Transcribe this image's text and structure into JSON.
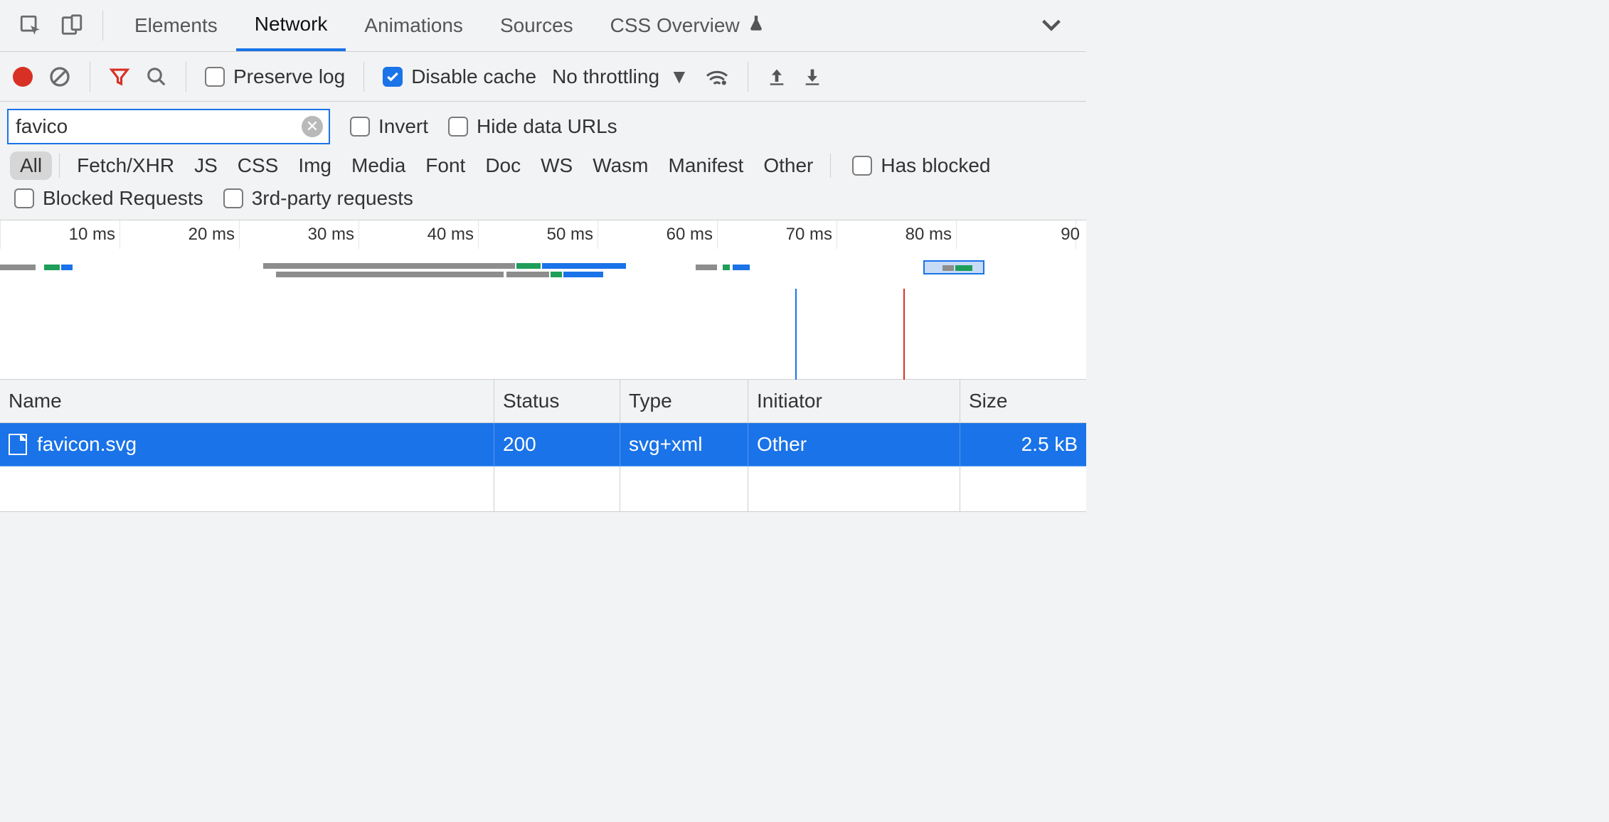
{
  "tabs": {
    "items": [
      "Elements",
      "Network",
      "Animations",
      "Sources",
      "CSS Overview"
    ],
    "active_index": 1
  },
  "toolbar": {
    "preserve_log_label": "Preserve log",
    "preserve_log_checked": false,
    "disable_cache_label": "Disable cache",
    "disable_cache_checked": true,
    "throttling_value": "No throttling"
  },
  "filter": {
    "value": "favico",
    "invert_label": "Invert",
    "invert_checked": false,
    "hide_data_urls_label": "Hide data URLs",
    "hide_data_urls_checked": false
  },
  "type_filters": {
    "items": [
      "All",
      "Fetch/XHR",
      "JS",
      "CSS",
      "Img",
      "Media",
      "Font",
      "Doc",
      "WS",
      "Wasm",
      "Manifest",
      "Other"
    ],
    "active_index": 0,
    "has_blocked_label": "Has blocked",
    "has_blocked_checked": false,
    "blocked_requests_label": "Blocked Requests",
    "blocked_requests_checked": false,
    "third_party_label": "3rd-party requests",
    "third_party_checked": false
  },
  "timeline": {
    "ticks": [
      "10 ms",
      "20 ms",
      "30 ms",
      "40 ms",
      "50 ms",
      "60 ms",
      "70 ms",
      "80 ms",
      "90"
    ],
    "load_line_ms": 67,
    "domcontent_line_ms": 76
  },
  "table": {
    "columns": [
      "Name",
      "Status",
      "Type",
      "Initiator",
      "Size"
    ],
    "rows": [
      {
        "name": "favicon.svg",
        "status": "200",
        "type": "svg+xml",
        "initiator": "Other",
        "size": "2.5 kB",
        "selected": true
      }
    ]
  }
}
